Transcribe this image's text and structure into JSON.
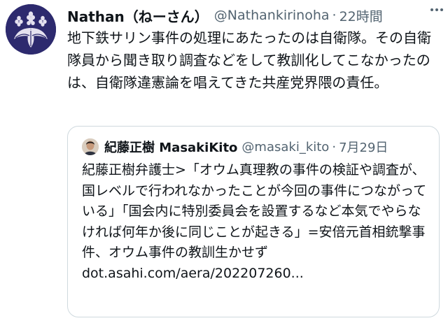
{
  "tweet": {
    "display_name": "Nathan（ねーさん）",
    "handle": "@Nathankirinoha",
    "separator": "·",
    "time": "22時間",
    "more_icon": "more-horizontal-icon",
    "text": "地下鉄サリン事件の処理にあたったのは自衛隊。その自衛隊員から聞き取り調査などをして教訓化してこなかったのは、自衛隊違憲論を唱えてきた共産党界隈の責任。"
  },
  "quoted_tweet": {
    "display_name": "紀藤正樹 MasakiKito",
    "handle": "@masaki_kito",
    "separator": "·",
    "date": "7月29日",
    "text": "紀藤正樹弁護士>「オウム真理教の事件の検証や調査が、国レベルで行われなかったことが今回の事件につながっている」「国会内に特別委員会を設置するなど本気でやらなければ何年か後に同じことが起きる」=安倍元首相銃撃事件、オウム事件の教訓生かせず",
    "link": "dot.asahi.com/aera/202207260..."
  },
  "colors": {
    "text_primary": "#0f1419",
    "text_secondary": "#536471",
    "border": "#cfd9de",
    "avatar_bg": "#2d2a6e",
    "emblem": "#e4e1ef"
  }
}
